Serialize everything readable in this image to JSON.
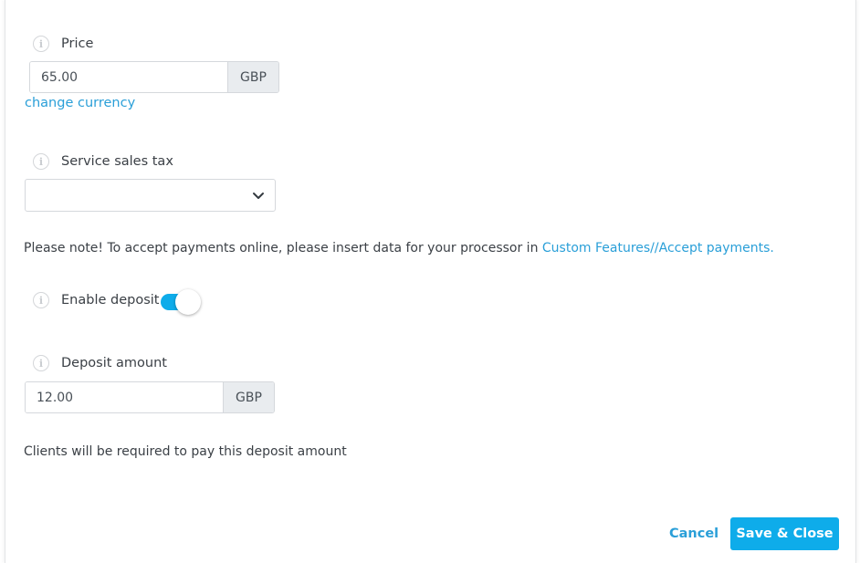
{
  "price": {
    "label": "Price",
    "value": "65.00",
    "currency": "GBP",
    "change_currency_link": "change currency"
  },
  "sales_tax": {
    "label": "Service sales tax",
    "selected": ""
  },
  "note": {
    "text": "Please note! To accept payments online, please insert data for your processor in ",
    "link": "Custom Features//Accept payments."
  },
  "deposit_toggle": {
    "label": "Enable deposit",
    "enabled": true
  },
  "deposit_amount": {
    "label": "Deposit amount",
    "value": "12.00",
    "currency": "GBP",
    "help_text": "Clients will be required to pay this deposit amount"
  },
  "footer": {
    "cancel_label": "Cancel",
    "save_label": "Save & Close"
  },
  "icons": {
    "info": "i"
  },
  "colors": {
    "accent": "#0eacea",
    "link": "#2a9fd8",
    "addon_bg": "#e9ecef"
  }
}
